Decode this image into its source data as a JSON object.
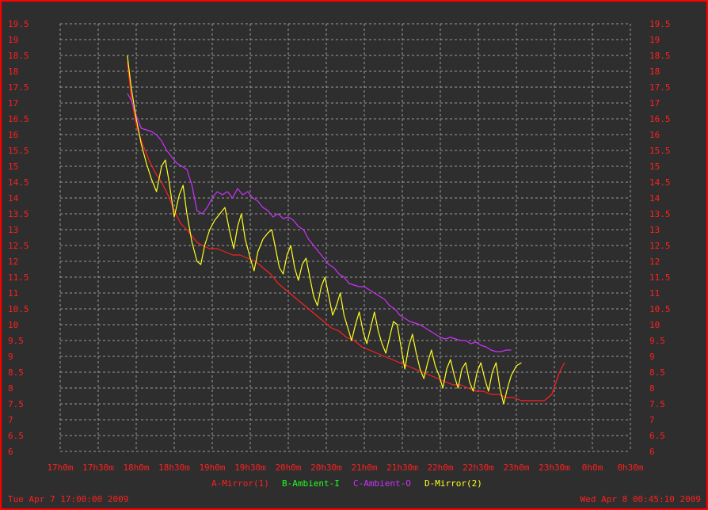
{
  "chart_data": {
    "type": "line",
    "x_ticks": [
      "17h0m",
      "17h30m",
      "18h0m",
      "18h30m",
      "19h0m",
      "19h30m",
      "20h0m",
      "20h30m",
      "21h0m",
      "21h30m",
      "22h0m",
      "22h30m",
      "23h0m",
      "23h30m",
      "0h0m",
      "0h30m"
    ],
    "y_ticks": [
      "19.5",
      "19",
      "18.5",
      "18",
      "17.5",
      "17",
      "16.5",
      "16",
      "15.5",
      "15",
      "14.5",
      "14",
      "13.5",
      "13",
      "12.5",
      "12",
      "11.5",
      "11",
      "10.5",
      "10",
      "9.5",
      "9",
      "8.5",
      "8",
      "7.5",
      "7",
      "6.5",
      "6"
    ],
    "ylim": [
      6,
      19.5
    ],
    "xlim_minutes_from_17h0m": [
      0,
      450
    ],
    "grid": true,
    "start_label": "Tue Apr  7 17:00:00 2009",
    "end_label": "Wed Apr  8 00:45:10 2009",
    "series": [
      {
        "name": "A-Mirror(1)",
        "color": "#ff2020",
        "points": [
          [
            53,
            18.3
          ],
          [
            56,
            17.2
          ],
          [
            60,
            16.3
          ],
          [
            65,
            15.7
          ],
          [
            70,
            15.2
          ],
          [
            75,
            14.8
          ],
          [
            80,
            14.5
          ],
          [
            85,
            14.1
          ],
          [
            90,
            13.6
          ],
          [
            95,
            13.2
          ],
          [
            100,
            13.0
          ],
          [
            104,
            12.8
          ],
          [
            108,
            12.6
          ],
          [
            112,
            12.5
          ],
          [
            118,
            12.4
          ],
          [
            124,
            12.4
          ],
          [
            130,
            12.3
          ],
          [
            136,
            12.2
          ],
          [
            142,
            12.2
          ],
          [
            148,
            12.1
          ],
          [
            154,
            12.0
          ],
          [
            160,
            11.8
          ],
          [
            166,
            11.6
          ],
          [
            172,
            11.3
          ],
          [
            178,
            11.1
          ],
          [
            184,
            10.9
          ],
          [
            190,
            10.7
          ],
          [
            196,
            10.5
          ],
          [
            202,
            10.3
          ],
          [
            208,
            10.1
          ],
          [
            214,
            9.9
          ],
          [
            220,
            9.8
          ],
          [
            226,
            9.6
          ],
          [
            232,
            9.5
          ],
          [
            238,
            9.3
          ],
          [
            244,
            9.2
          ],
          [
            250,
            9.1
          ],
          [
            256,
            9.0
          ],
          [
            262,
            8.9
          ],
          [
            268,
            8.8
          ],
          [
            274,
            8.7
          ],
          [
            280,
            8.6
          ],
          [
            286,
            8.5
          ],
          [
            292,
            8.4
          ],
          [
            298,
            8.3
          ],
          [
            304,
            8.2
          ],
          [
            310,
            8.1
          ],
          [
            316,
            8.1
          ],
          [
            322,
            8.0
          ],
          [
            328,
            7.9
          ],
          [
            334,
            7.9
          ],
          [
            340,
            7.8
          ],
          [
            346,
            7.8
          ],
          [
            352,
            7.7
          ],
          [
            358,
            7.7
          ],
          [
            364,
            7.6
          ],
          [
            370,
            7.6
          ],
          [
            376,
            7.6
          ],
          [
            382,
            7.6
          ],
          [
            388,
            7.8
          ],
          [
            394,
            8.5
          ],
          [
            398,
            8.8
          ]
        ]
      },
      {
        "name": "B-Ambient-I",
        "color": "#20ff20",
        "points": []
      },
      {
        "name": "C-Ambient-O",
        "color": "#d030ff",
        "points": [
          [
            53,
            17.3
          ],
          [
            56,
            17.1
          ],
          [
            60,
            16.6
          ],
          [
            64,
            16.2
          ],
          [
            68,
            16.15
          ],
          [
            72,
            16.1
          ],
          [
            76,
            16.0
          ],
          [
            80,
            15.8
          ],
          [
            84,
            15.5
          ],
          [
            88,
            15.3
          ],
          [
            92,
            15.1
          ],
          [
            96,
            15.0
          ],
          [
            100,
            14.9
          ],
          [
            104,
            14.4
          ],
          [
            108,
            13.6
          ],
          [
            112,
            13.5
          ],
          [
            116,
            13.7
          ],
          [
            120,
            14.0
          ],
          [
            124,
            14.2
          ],
          [
            128,
            14.1
          ],
          [
            132,
            14.2
          ],
          [
            136,
            14.0
          ],
          [
            140,
            14.3
          ],
          [
            144,
            14.1
          ],
          [
            148,
            14.2
          ],
          [
            152,
            14.0
          ],
          [
            156,
            13.9
          ],
          [
            160,
            13.7
          ],
          [
            164,
            13.6
          ],
          [
            168,
            13.4
          ],
          [
            172,
            13.5
          ],
          [
            176,
            13.35
          ],
          [
            180,
            13.4
          ],
          [
            184,
            13.3
          ],
          [
            188,
            13.1
          ],
          [
            192,
            13.0
          ],
          [
            196,
            12.7
          ],
          [
            200,
            12.5
          ],
          [
            204,
            12.3
          ],
          [
            208,
            12.1
          ],
          [
            212,
            11.9
          ],
          [
            216,
            11.8
          ],
          [
            220,
            11.6
          ],
          [
            224,
            11.5
          ],
          [
            228,
            11.3
          ],
          [
            232,
            11.25
          ],
          [
            236,
            11.2
          ],
          [
            240,
            11.2
          ],
          [
            244,
            11.1
          ],
          [
            248,
            11.0
          ],
          [
            252,
            10.9
          ],
          [
            256,
            10.8
          ],
          [
            260,
            10.6
          ],
          [
            264,
            10.5
          ],
          [
            268,
            10.3
          ],
          [
            272,
            10.2
          ],
          [
            276,
            10.1
          ],
          [
            280,
            10.05
          ],
          [
            284,
            10.0
          ],
          [
            288,
            9.9
          ],
          [
            292,
            9.8
          ],
          [
            296,
            9.7
          ],
          [
            300,
            9.6
          ],
          [
            304,
            9.55
          ],
          [
            308,
            9.6
          ],
          [
            312,
            9.55
          ],
          [
            316,
            9.5
          ],
          [
            320,
            9.5
          ],
          [
            324,
            9.4
          ],
          [
            328,
            9.45
          ],
          [
            332,
            9.35
          ],
          [
            336,
            9.3
          ],
          [
            340,
            9.2
          ],
          [
            344,
            9.15
          ],
          [
            348,
            9.15
          ],
          [
            352,
            9.2
          ],
          [
            356,
            9.2
          ]
        ]
      },
      {
        "name": "D-Mirror(2)",
        "color": "#ffff20",
        "points": [
          [
            53,
            18.5
          ],
          [
            56,
            17.5
          ],
          [
            60,
            16.5
          ],
          [
            64,
            15.7
          ],
          [
            68,
            15.1
          ],
          [
            72,
            14.6
          ],
          [
            76,
            14.2
          ],
          [
            80,
            15.0
          ],
          [
            83,
            15.2
          ],
          [
            86,
            14.5
          ],
          [
            90,
            13.4
          ],
          [
            94,
            14.1
          ],
          [
            97,
            14.4
          ],
          [
            100,
            13.5
          ],
          [
            104,
            12.6
          ],
          [
            108,
            12.0
          ],
          [
            111,
            11.9
          ],
          [
            114,
            12.5
          ],
          [
            118,
            13.0
          ],
          [
            122,
            13.3
          ],
          [
            126,
            13.5
          ],
          [
            130,
            13.7
          ],
          [
            134,
            12.9
          ],
          [
            137,
            12.4
          ],
          [
            140,
            13.1
          ],
          [
            143,
            13.5
          ],
          [
            146,
            12.7
          ],
          [
            150,
            12.1
          ],
          [
            153,
            11.7
          ],
          [
            156,
            12.3
          ],
          [
            160,
            12.7
          ],
          [
            164,
            12.9
          ],
          [
            167,
            13.0
          ],
          [
            170,
            12.4
          ],
          [
            173,
            11.8
          ],
          [
            176,
            11.6
          ],
          [
            179,
            12.2
          ],
          [
            182,
            12.5
          ],
          [
            185,
            11.8
          ],
          [
            188,
            11.4
          ],
          [
            191,
            11.9
          ],
          [
            194,
            12.1
          ],
          [
            197,
            11.5
          ],
          [
            200,
            10.9
          ],
          [
            203,
            10.6
          ],
          [
            206,
            11.2
          ],
          [
            209,
            11.5
          ],
          [
            212,
            10.9
          ],
          [
            215,
            10.3
          ],
          [
            218,
            10.6
          ],
          [
            221,
            11.0
          ],
          [
            224,
            10.3
          ],
          [
            227,
            9.9
          ],
          [
            230,
            9.5
          ],
          [
            233,
            10.0
          ],
          [
            236,
            10.4
          ],
          [
            239,
            9.8
          ],
          [
            242,
            9.4
          ],
          [
            245,
            9.9
          ],
          [
            248,
            10.4
          ],
          [
            251,
            9.8
          ],
          [
            254,
            9.4
          ],
          [
            257,
            9.1
          ],
          [
            260,
            9.6
          ],
          [
            263,
            10.1
          ],
          [
            266,
            10.0
          ],
          [
            269,
            9.3
          ],
          [
            272,
            8.6
          ],
          [
            275,
            9.3
          ],
          [
            278,
            9.7
          ],
          [
            281,
            9.1
          ],
          [
            284,
            8.6
          ],
          [
            287,
            8.3
          ],
          [
            290,
            8.8
          ],
          [
            293,
            9.2
          ],
          [
            296,
            8.7
          ],
          [
            299,
            8.4
          ],
          [
            302,
            8.0
          ],
          [
            305,
            8.6
          ],
          [
            308,
            8.9
          ],
          [
            311,
            8.4
          ],
          [
            314,
            8.0
          ],
          [
            317,
            8.6
          ],
          [
            320,
            8.8
          ],
          [
            323,
            8.2
          ],
          [
            326,
            7.9
          ],
          [
            329,
            8.5
          ],
          [
            332,
            8.8
          ],
          [
            335,
            8.3
          ],
          [
            338,
            7.9
          ],
          [
            341,
            8.5
          ],
          [
            344,
            8.8
          ],
          [
            347,
            8.0
          ],
          [
            350,
            7.5
          ],
          [
            353,
            8.0
          ],
          [
            356,
            8.4
          ],
          [
            360,
            8.7
          ],
          [
            364,
            8.8
          ]
        ]
      }
    ]
  }
}
